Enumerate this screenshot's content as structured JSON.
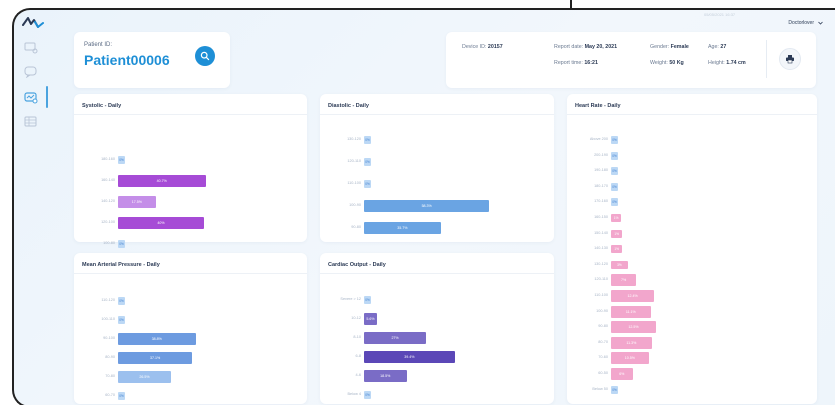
{
  "header": {
    "user": "Doctorlover",
    "top_faint": "05/05/2021 16:37"
  },
  "patient": {
    "label": "Patient ID:",
    "id": "Patient00006"
  },
  "info": {
    "device_label": "Device ID:",
    "device_value": "20157",
    "report_date_label": "Report date:",
    "report_date_value": "May 20, 2021",
    "report_time_label": "Report time:",
    "report_time_value": "16:21",
    "gender_label": "Gender:",
    "gender_value": "Female",
    "weight_label": "Weight:",
    "weight_value": "50 Kg",
    "age_label": "Age:",
    "age_value": "27",
    "height_label": "Height:",
    "height_value": "1.74 cm"
  },
  "colors": {
    "accent": "#1e8fd6",
    "systolic": "#a64bd6",
    "systolic_light": "#c48ee8",
    "diastolic": "#6aa4e3",
    "map": "#6d9be0",
    "map_light": "#9cc0ee",
    "cardiac": "#7a6cc6",
    "cardiac_dark": "#5b47b7",
    "heart": "#f2a6cc"
  },
  "panels": {
    "systolic": {
      "title": "Systolic - Daily",
      "rows": [
        {
          "label": "180-160",
          "value": 0,
          "text": "0%"
        },
        {
          "label": "160-140",
          "value": 40.7,
          "text": "40.7%"
        },
        {
          "label": "140-120",
          "value": 17.5,
          "text": "17.5%"
        },
        {
          "label": "120-100",
          "value": 40,
          "text": "40%"
        },
        {
          "label": "100-80",
          "value": 0,
          "text": "0%"
        }
      ]
    },
    "diastolic": {
      "title": "Diastolic - Daily",
      "rows": [
        {
          "label": "130-120",
          "value": 0,
          "text": "0%"
        },
        {
          "label": "120-110",
          "value": 0,
          "text": "0%"
        },
        {
          "label": "110-100",
          "value": 0,
          "text": "0%"
        },
        {
          "label": "100-90",
          "value": 58.3,
          "text": "58.3%"
        },
        {
          "label": "90-80",
          "value": 35.7,
          "text": "35.7%"
        }
      ]
    },
    "map": {
      "title": "Mean Arterial Pressure - Daily",
      "rows": [
        {
          "label": "110-120",
          "value": 0,
          "text": "0%"
        },
        {
          "label": "100-110",
          "value": 0,
          "text": "0%"
        },
        {
          "label": "90-100",
          "value": 38.8,
          "text": "38.8%"
        },
        {
          "label": "80-90",
          "value": 37.1,
          "text": "37.1%"
        },
        {
          "label": "70-80",
          "value": 26.5,
          "text": "26.5%"
        },
        {
          "label": "60-70",
          "value": 0,
          "text": "0%"
        }
      ]
    },
    "cardiac": {
      "title": "Cardiac Output - Daily",
      "rows": [
        {
          "label": "Severe > 12",
          "value": 0,
          "text": "0%"
        },
        {
          "label": "10-12",
          "value": 5.6,
          "text": "5.6%"
        },
        {
          "label": "8-10",
          "value": 27,
          "text": "27%"
        },
        {
          "label": "6-8",
          "value": 39.4,
          "text": "39.4%"
        },
        {
          "label": "4-6",
          "value": 18.5,
          "text": "18.5%"
        },
        {
          "label": "Below 4",
          "value": 0,
          "text": "0%"
        }
      ]
    },
    "heart": {
      "title": "Heart Rate - Daily",
      "rows": [
        {
          "label": "Above 200",
          "value": 0,
          "text": "0%"
        },
        {
          "label": "200-190",
          "value": 0,
          "text": "0%"
        },
        {
          "label": "190-180",
          "value": 0,
          "text": "0%"
        },
        {
          "label": "180-170",
          "value": 0,
          "text": "0%"
        },
        {
          "label": "170-160",
          "value": 0,
          "text": "0%"
        },
        {
          "label": "160-150",
          "value": 1.2,
          "text": "1%"
        },
        {
          "label": "150-140",
          "value": 1.5,
          "text": "1%"
        },
        {
          "label": "140-130",
          "value": 1.5,
          "text": "1%"
        },
        {
          "label": "130-120",
          "value": 3,
          "text": "3%"
        },
        {
          "label": "120-110",
          "value": 7,
          "text": "7%"
        },
        {
          "label": "110-100",
          "value": 12,
          "text": "12.4%"
        },
        {
          "label": "100-90",
          "value": 11,
          "text": "11.1%"
        },
        {
          "label": "90-80",
          "value": 12.5,
          "text": "12.5%"
        },
        {
          "label": "80-70",
          "value": 11.3,
          "text": "11.3%"
        },
        {
          "label": "70-60",
          "value": 10.5,
          "text": "10.5%"
        },
        {
          "label": "60-50",
          "value": 6,
          "text": "6%"
        },
        {
          "label": "Below 50",
          "value": 0,
          "text": "0%"
        }
      ]
    }
  }
}
